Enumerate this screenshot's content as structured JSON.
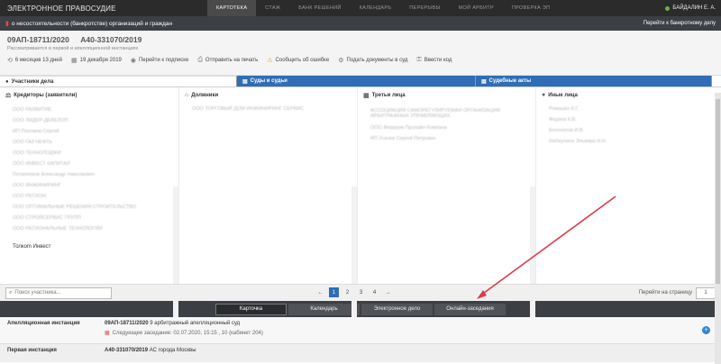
{
  "topbar": {
    "brand": "ЭЛЕКТРОННОЕ ПРАВОСУДИЕ",
    "nav": [
      "КАРТОТЕКА",
      "СТАЖ",
      "БАНК РЕШЕНИЙ",
      "КАЛЕНДАРЬ",
      "ПЕРЕРЫВЫ",
      "МОЙ АРБИТР",
      "ПРОВЕРКА ЭП"
    ],
    "user": "БАЙДАЛИН Е. А."
  },
  "subbar": {
    "title": "о несостоятельности (банкротстве) организаций и граждан",
    "right_link": "Перейти к банкротному делу"
  },
  "case": {
    "number1": "09АП-18711/2020",
    "number2": "А40-331070/2019",
    "subtitle": "Рассматривается в первой и апелляционной инстанциях",
    "toolbar": {
      "duration": "6 месяцев 13 дней",
      "date": "19 декабря 2019",
      "subscribe": "Перейти к подписке",
      "print": "Отправить на печать",
      "report": "Сообщить об ошибке",
      "submit": "Подать документы в суд",
      "login": "Ввести код"
    }
  },
  "tabs": {
    "participants": "Участники дела",
    "courts": "Суды и судьи",
    "acts": "Судебные акты"
  },
  "columns": {
    "creditors": {
      "title": "Кредиторы (заявители)",
      "items": [
        "ООО РАЗВИТИЕ",
        "ООО ЛИДЕР-ДЕВЕЛОП",
        "ИП Пахомов Сергей",
        "ООО ГАЗ НЕФТЬ",
        "ООО ТЕХНОЛОДЖИ",
        "ООО ИНВЕСТ КАПИТАЛ",
        "Потапенков Александр Николаевич",
        "ООО ИНЖИНИРИНГ",
        "ООО РЕГИОН",
        "ООО ОПТИМАЛЬНЫЕ РЕШЕНИЯ СТРОИТЕЛЬСТВО",
        "ООО СТРОЙСЕРВИС ГРУПП",
        "ООО РЕГИОНАЛЬНЫЕ ТЕХНОЛОГИИ",
        "Толкоm Инвест"
      ]
    },
    "debtors": {
      "title": "Должники",
      "items": [
        "ООО ТОРГОВЫЙ ДОМ ИНЖИНИРИНГ СЕРВИС"
      ]
    },
    "third": {
      "title": "Третьи лица",
      "items": [
        "АССОЦИАЦИЯ САМОРЕГУЛИРУЕМАЯ ОРГАНИЗАЦИЯ АРБИТРАЖНЫХ УПРАВЛЯЮЩИХ",
        "ООО Ферррум Пролайн Компани",
        "ИП Усачев Сергей Петрович"
      ]
    },
    "other": {
      "title": "Иные лица",
      "items": [
        "Ромашко К.Г.",
        "Федяев К.В.",
        "Белоногов И.В.",
        "Набиулина Эльвира Н.Н."
      ]
    }
  },
  "bottom": {
    "search_placeholder": "Поиск участника...",
    "pages": [
      "←",
      "1",
      "2",
      "3",
      "4",
      "→"
    ],
    "goto_label": "Перейти на страницу",
    "goto_value": "1"
  },
  "footer_tabs": [
    "Карточка",
    "Календарь",
    "Электронное дело",
    "Онлайн-заседания"
  ],
  "instances": {
    "appeal": {
      "label": "Апелляционная инстанция",
      "case": "09АП-18711/2020",
      "court": "9 арбитражный апелляционный суд",
      "next": "Следующее заседание: 02.07.2020, 15:15 , 10 (кабинет 204)"
    },
    "first": {
      "label": "Первая инстанция",
      "case": "А40-331070/2019",
      "court": "АС города Москвы"
    }
  },
  "colors": {
    "accent": "#2f6db5",
    "arrow": "#e0394a",
    "topbar": "#2b2b2b"
  }
}
